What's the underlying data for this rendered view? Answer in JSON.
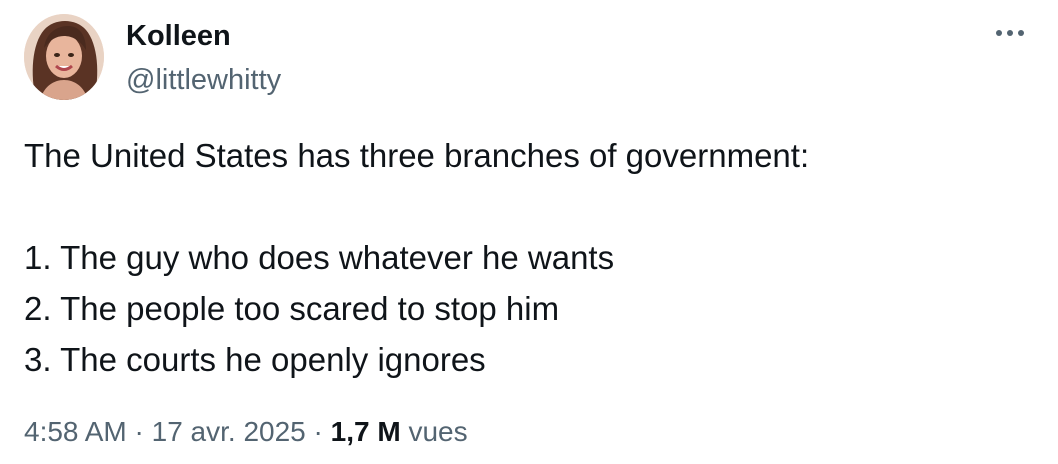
{
  "author": {
    "display_name": "Kolleen",
    "handle": "@littlewhitty"
  },
  "tweet": {
    "lines": [
      "The United States has three branches of government:",
      "",
      "1. The guy who does whatever he wants",
      "2. The people too scared to stop him",
      "3. The courts he openly ignores"
    ]
  },
  "meta": {
    "time": "4:58 AM",
    "separator": "·",
    "date": "17 avr. 2025",
    "views_count": "1,7 M",
    "views_label": "vues"
  },
  "icons": {
    "more": "more-horizontal-icon",
    "avatar": "profile-photo"
  },
  "colors": {
    "text_primary": "#0f1419",
    "text_secondary": "#536471",
    "background": "#ffffff"
  }
}
